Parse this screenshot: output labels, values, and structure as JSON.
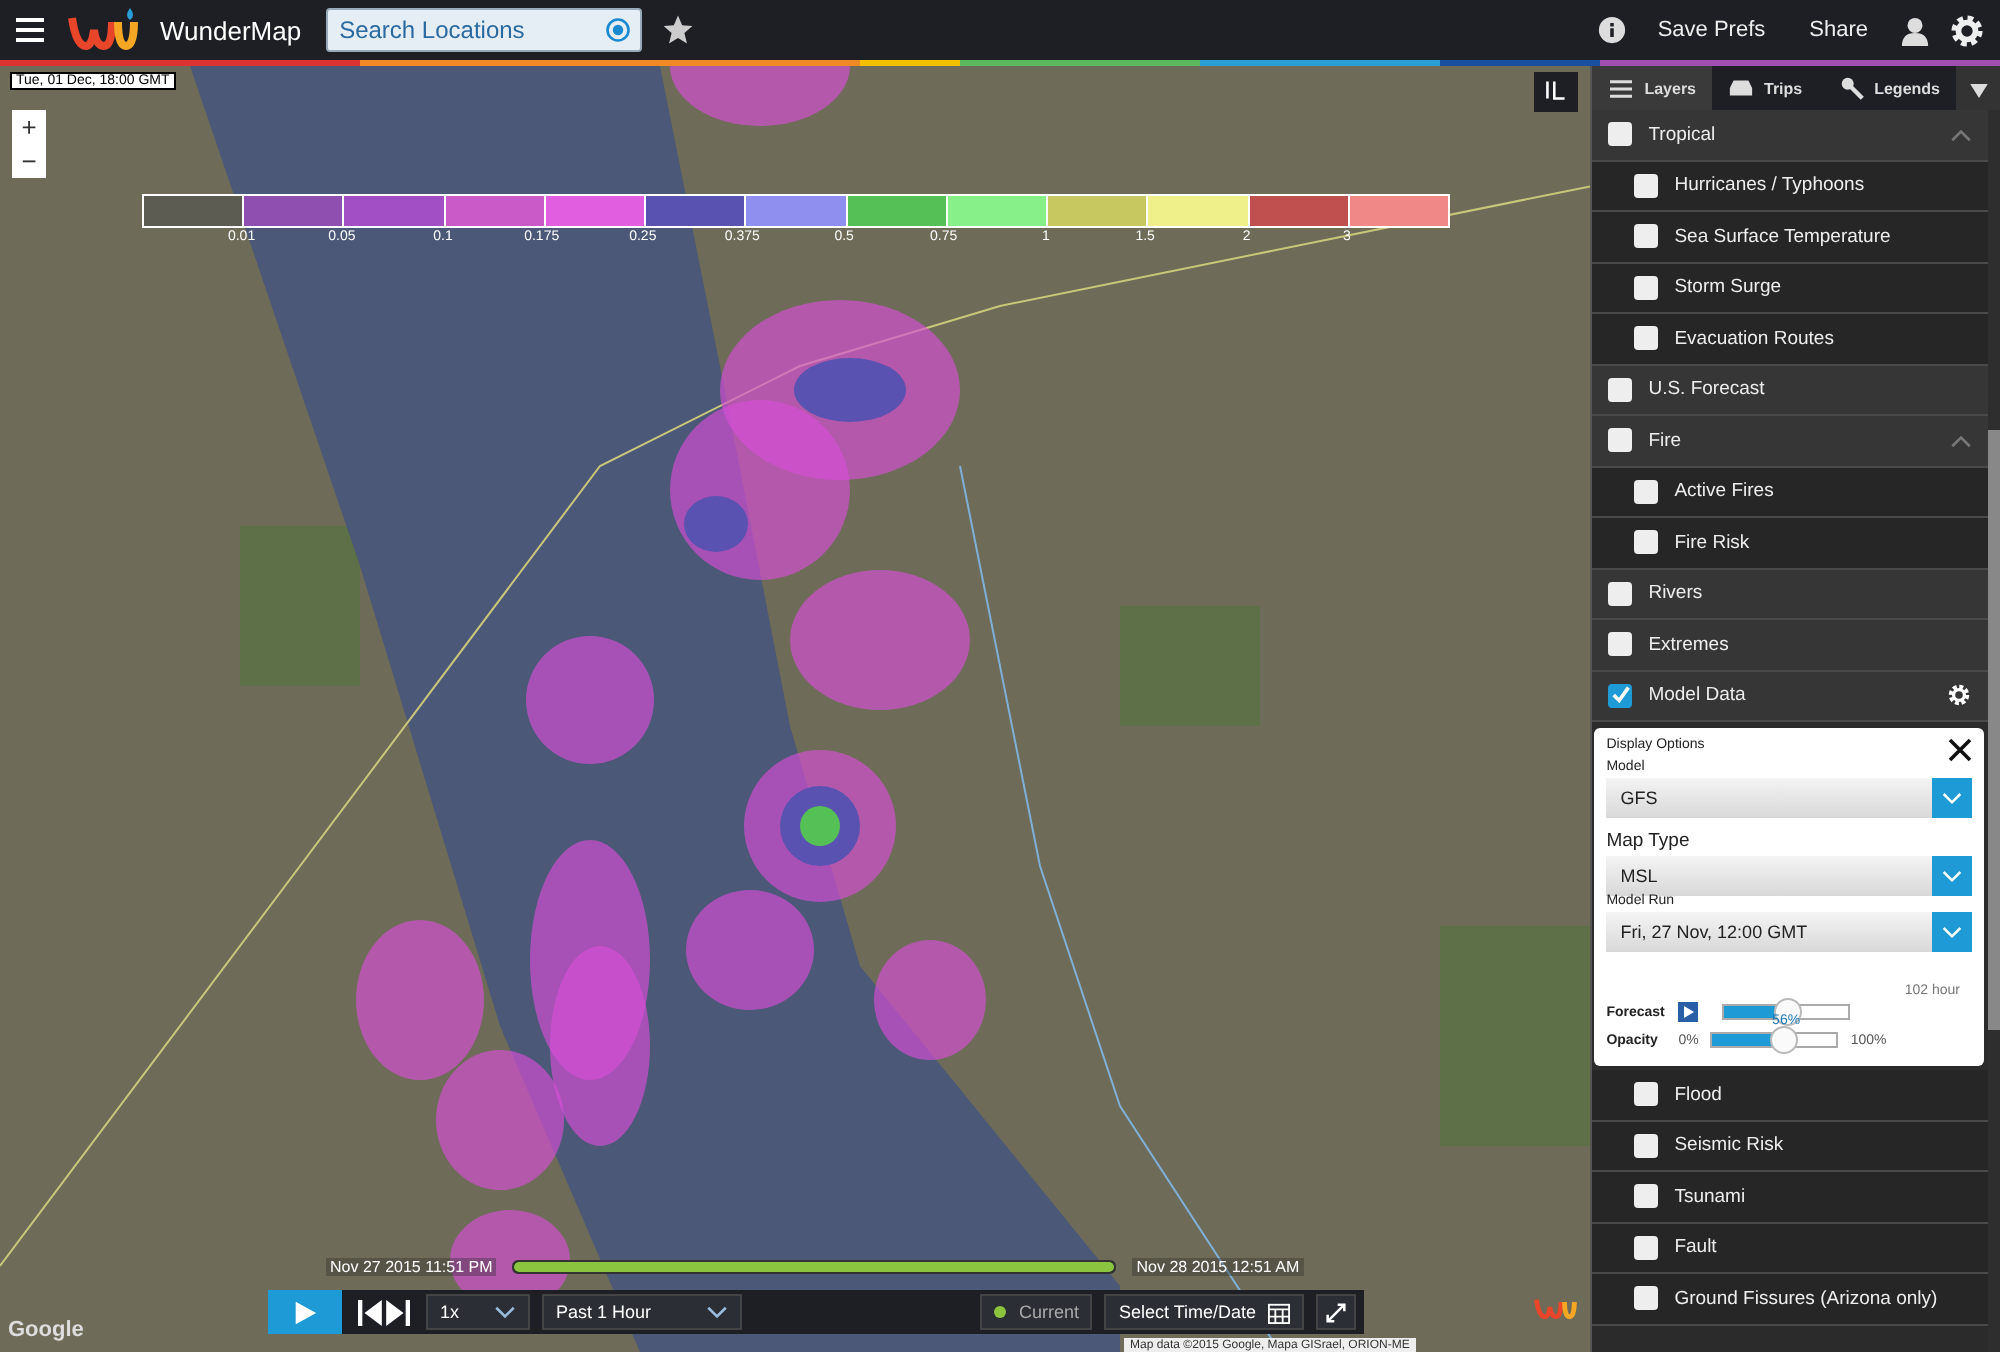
{
  "header": {
    "brand": "WunderMap",
    "search": {
      "placeholder": "Search Locations"
    },
    "actions": [
      "Save Prefs",
      "Share"
    ]
  },
  "map": {
    "timestamp": "Tue, 01 Dec, 18:00 GMT",
    "zoom_in": "+",
    "zoom_out": "−",
    "attribution": "Map data ©2015 Google, Mapa GISrael, ORION-ME",
    "logo": "Google",
    "legend": {
      "swatches": [
        {
          "color": "#5c5c52"
        },
        {
          "color": "#8e4fb0"
        },
        {
          "color": "#a24fc6"
        },
        {
          "color": "#c95ac8"
        },
        {
          "color": "#e25ee0"
        },
        {
          "color": "#5a52b0"
        },
        {
          "color": "#8f8ff0"
        },
        {
          "color": "#55c055"
        },
        {
          "color": "#88f088"
        },
        {
          "color": "#c8c860"
        },
        {
          "color": "#f0f08a"
        },
        {
          "color": "#c05050"
        },
        {
          "color": "#f08888"
        }
      ],
      "ticks": [
        "0.01",
        "0.05",
        "0.1",
        "0.175",
        "0.25",
        "0.375",
        "0.5",
        "0.75",
        "1",
        "1.5",
        "2",
        "3"
      ]
    }
  },
  "timeline": {
    "start": "Nov 27 2015 11:51 PM",
    "end": "Nov 28 2015 12:51 AM",
    "level": 1
  },
  "playback": {
    "speed": "1x",
    "range": "Past 1 Hour",
    "current": "Current",
    "select": "Select Time/Date"
  },
  "tabs": [
    {
      "label": "Layers",
      "kind": "layers",
      "selected": true
    },
    {
      "label": "Trips",
      "kind": "trips",
      "selected": false
    },
    {
      "label": "Legends",
      "kind": "legends",
      "selected": false
    }
  ],
  "layers": [
    {
      "label": "Tropical",
      "checked": false,
      "expanded": true,
      "children": [
        {
          "label": "Hurricanes / Typhoons",
          "checked": false
        },
        {
          "label": "Sea Surface Temperature",
          "checked": false
        },
        {
          "label": "Storm Surge",
          "checked": false
        },
        {
          "label": "Evacuation Routes",
          "checked": false
        }
      ]
    },
    {
      "label": "U.S. Forecast",
      "checked": false
    },
    {
      "label": "Fire",
      "checked": false,
      "expanded": true,
      "children": [
        {
          "label": "Active Fires",
          "checked": false
        },
        {
          "label": "Fire Risk",
          "checked": false
        }
      ]
    },
    {
      "label": "Rivers",
      "checked": false
    },
    {
      "label": "Extremes",
      "checked": false
    },
    {
      "label": "Model Data",
      "checked": true,
      "settings": true
    }
  ],
  "options": {
    "title": "Display Options",
    "fields": [
      {
        "label": "Model",
        "kind": "small",
        "value": "GFS"
      },
      {
        "label": "Map Type",
        "kind": "large",
        "value": "MSL"
      },
      {
        "label": "Model Run",
        "kind": "small",
        "value": "Fri, 27 Nov, 12:00 GMT"
      }
    ],
    "forecast": {
      "label": "Forecast",
      "max": "102 hour",
      "level": 0.5
    },
    "opacity": {
      "label": "Opacity",
      "min": "0%",
      "max": "100%",
      "reading": "56%",
      "level": 0.56
    }
  },
  "more_layers": [
    {
      "label": "Flood",
      "checked": false
    },
    {
      "label": "Seismic Risk",
      "checked": false
    },
    {
      "label": "Tsunami",
      "checked": false
    },
    {
      "label": "Fault",
      "checked": false
    },
    {
      "label": "Ground Fissures (Arizona only)",
      "checked": false
    }
  ]
}
